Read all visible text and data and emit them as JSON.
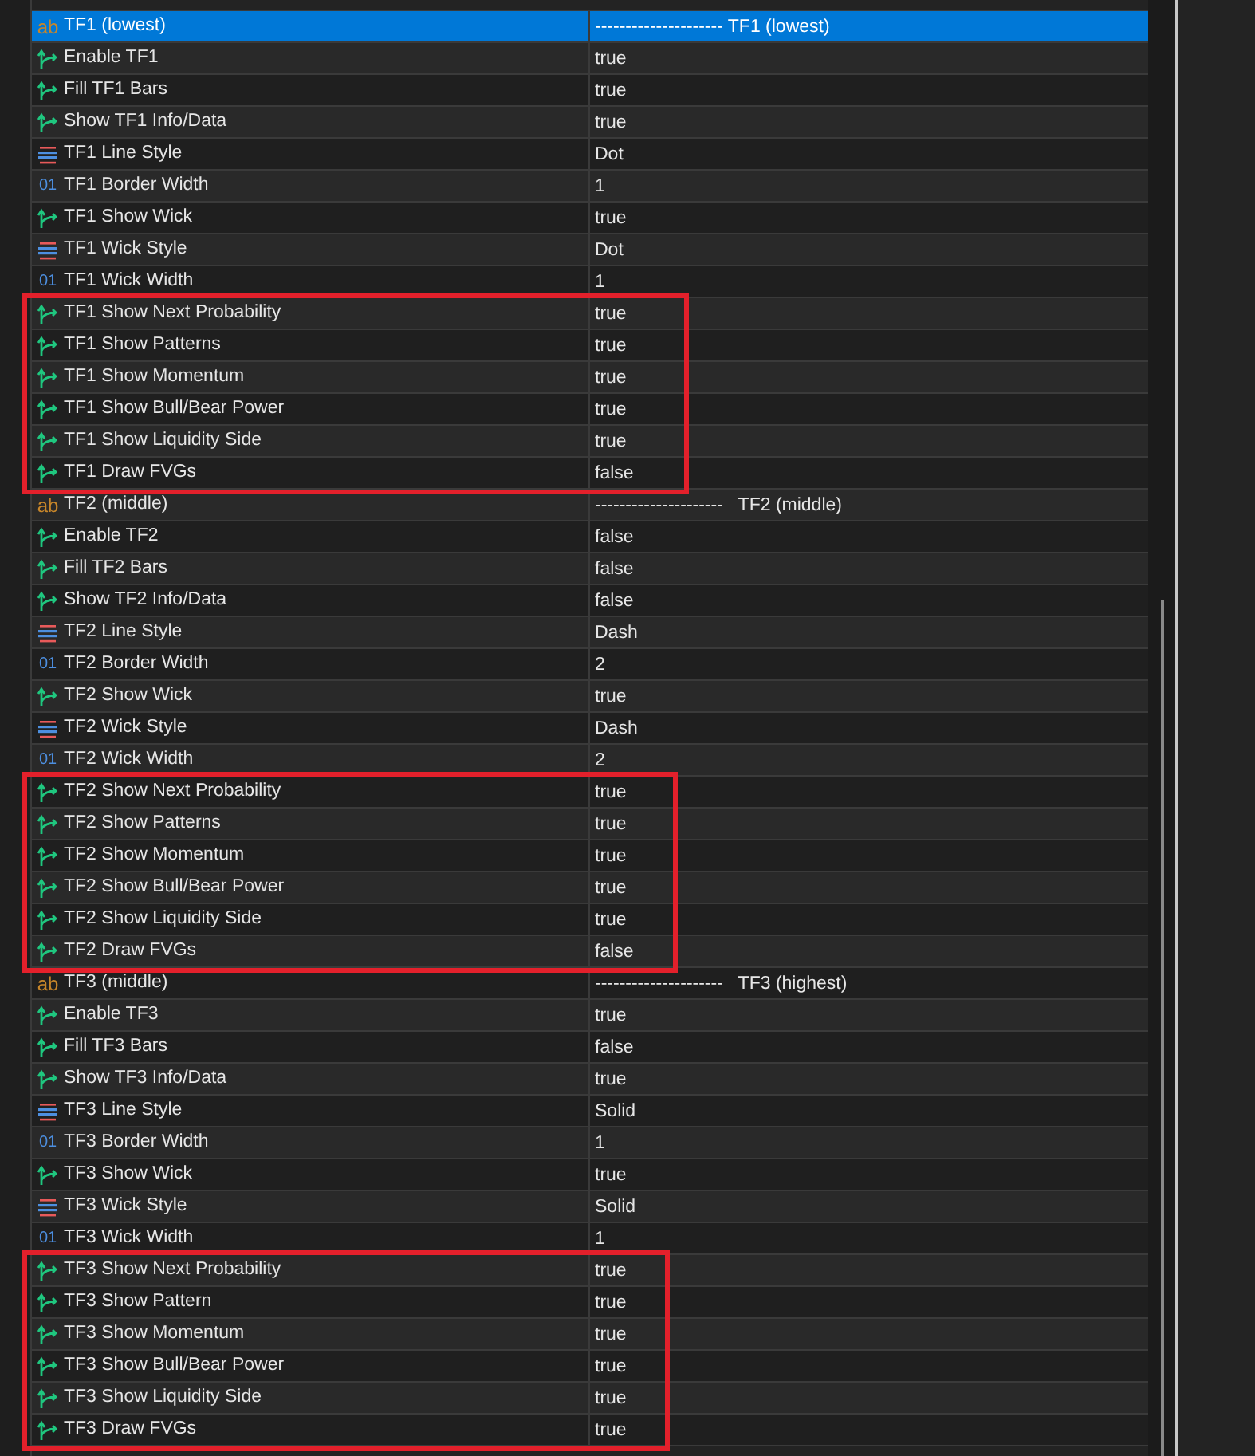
{
  "groups": [
    {
      "header": {
        "icon_text": "ab",
        "name": "TF1 (lowest)",
        "value": "--------------------- TF1 (lowest)",
        "selected": true
      },
      "rows": [
        {
          "kind": "bool",
          "name": "Enable TF1",
          "value": "true"
        },
        {
          "kind": "bool",
          "name": "Fill TF1 Bars",
          "value": "true"
        },
        {
          "kind": "bool",
          "name": "Show TF1 Info/Data",
          "value": "true"
        },
        {
          "kind": "enum",
          "name": "TF1 Line Style",
          "value": "Dot"
        },
        {
          "kind": "int",
          "icon_text": "01",
          "name": "TF1 Border Width",
          "value": "1"
        },
        {
          "kind": "bool",
          "name": "TF1 Show Wick",
          "value": "true"
        },
        {
          "kind": "enum",
          "name": "TF1 Wick Style",
          "value": "Dot"
        },
        {
          "kind": "int",
          "icon_text": "01",
          "name": "TF1 Wick Width",
          "value": "1"
        }
      ],
      "highlighted_rows": [
        {
          "kind": "bool",
          "name": "TF1 Show Next Probability",
          "value": "true"
        },
        {
          "kind": "bool",
          "name": "TF1 Show Patterns",
          "value": "true"
        },
        {
          "kind": "bool",
          "name": "TF1 Show Momentum",
          "value": "true"
        },
        {
          "kind": "bool",
          "name": "TF1 Show Bull/Bear Power",
          "value": "true"
        },
        {
          "kind": "bool",
          "name": "TF1 Show Liquidity Side",
          "value": "true"
        },
        {
          "kind": "bool",
          "name": "TF1 Draw FVGs",
          "value": "false"
        }
      ]
    },
    {
      "header": {
        "icon_text": "ab",
        "name": "TF2 (middle)",
        "value": "---------------------   TF2 (middle)",
        "selected": false
      },
      "rows": [
        {
          "kind": "bool",
          "name": "Enable TF2",
          "value": "false"
        },
        {
          "kind": "bool",
          "name": "Fill TF2 Bars",
          "value": "false"
        },
        {
          "kind": "bool",
          "name": "Show TF2 Info/Data",
          "value": "false"
        },
        {
          "kind": "enum",
          "name": "TF2 Line Style",
          "value": "Dash"
        },
        {
          "kind": "int",
          "icon_text": "01",
          "name": "TF2 Border Width",
          "value": "2"
        },
        {
          "kind": "bool",
          "name": "TF2 Show Wick",
          "value": "true"
        },
        {
          "kind": "enum",
          "name": "TF2 Wick Style",
          "value": "Dash"
        },
        {
          "kind": "int",
          "icon_text": "01",
          "name": "TF2 Wick Width",
          "value": "2"
        }
      ],
      "highlighted_rows": [
        {
          "kind": "bool",
          "name": "TF2 Show Next Probability",
          "value": "true"
        },
        {
          "kind": "bool",
          "name": "TF2 Show Patterns",
          "value": "true"
        },
        {
          "kind": "bool",
          "name": "TF2 Show Momentum",
          "value": "true"
        },
        {
          "kind": "bool",
          "name": "TF2 Show Bull/Bear Power",
          "value": "true"
        },
        {
          "kind": "bool",
          "name": "TF2 Show Liquidity Side",
          "value": "true"
        },
        {
          "kind": "bool",
          "name": "TF2 Draw FVGs",
          "value": "false"
        }
      ]
    },
    {
      "header": {
        "icon_text": "ab",
        "name": "TF3 (middle)",
        "value": "---------------------   TF3 (highest)",
        "selected": false
      },
      "rows": [
        {
          "kind": "bool",
          "name": "Enable TF3",
          "value": "true"
        },
        {
          "kind": "bool",
          "name": "Fill TF3 Bars",
          "value": "false"
        },
        {
          "kind": "bool",
          "name": "Show TF3 Info/Data",
          "value": "true"
        },
        {
          "kind": "enum",
          "name": "TF3 Line Style",
          "value": "Solid"
        },
        {
          "kind": "int",
          "icon_text": "01",
          "name": "TF3 Border Width",
          "value": "1"
        },
        {
          "kind": "bool",
          "name": "TF3 Show Wick",
          "value": "true"
        },
        {
          "kind": "enum",
          "name": "TF3 Wick Style",
          "value": "Solid"
        },
        {
          "kind": "int",
          "icon_text": "01",
          "name": "TF3 Wick Width",
          "value": "1"
        }
      ],
      "highlighted_rows": [
        {
          "kind": "bool",
          "name": "TF3 Show Next Probability",
          "value": "true"
        },
        {
          "kind": "bool",
          "name": "TF3 Show Pattern",
          "value": "true"
        },
        {
          "kind": "bool",
          "name": "TF3 Show Momentum",
          "value": "true"
        },
        {
          "kind": "bool",
          "name": "TF3 Show Bull/Bear Power",
          "value": "true"
        },
        {
          "kind": "bool",
          "name": "TF3 Show Liquidity Side",
          "value": "true"
        },
        {
          "kind": "bool",
          "name": "TF3 Draw FVGs",
          "value": "true"
        }
      ]
    }
  ]
}
